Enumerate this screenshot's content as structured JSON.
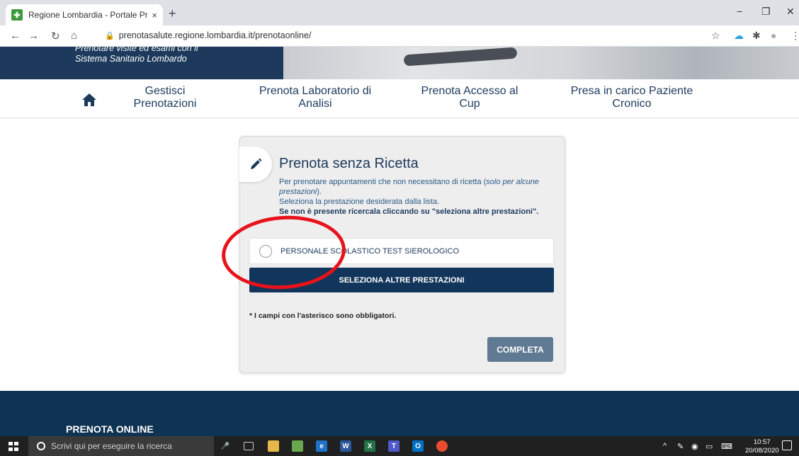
{
  "browser": {
    "tab_title": "Regione Lombardia - Portale Pre",
    "tab_close": "×",
    "new_tab": "+",
    "url": "prenotasalute.regione.lombardia.it/prenotaonline/",
    "window_minimize": "−",
    "window_restore": "❐",
    "window_close": "✕"
  },
  "banner": {
    "line1": "Prenotare visite ed esami con il",
    "line2": "Sistema Sanitario Lombardo"
  },
  "nav": {
    "items": [
      {
        "line1": "Gestisci",
        "line2": "Prenotazioni"
      },
      {
        "line1": "Prenota Laboratorio di",
        "line2": "Analisi"
      },
      {
        "line1": "Prenota Accesso al",
        "line2": "Cup"
      },
      {
        "line1": "Presa in carico Paziente",
        "line2": "Cronico"
      }
    ]
  },
  "card": {
    "title": "Prenota senza Ricetta",
    "desc_part1": "Per prenotare appuntamenti che non necessitano di ricetta (",
    "desc_italic": "solo per alcune prestazioni",
    "desc_part2": ").",
    "desc_line2": "Seleziona la prestazione desiderata dalla lista.",
    "desc_line3": "Se non è presente ricercala cliccando su \"seleziona altre prestazioni\".",
    "option_label": "PERSONALE SCOLASTICO TEST SIEROLOGICO",
    "altre_button": "SELEZIONA ALTRE PRESTAZIONI",
    "required_note": "* I campi con l'asterisco sono obbligatori.",
    "completa_button": "COMPLETA"
  },
  "footer": {
    "title": "PRENOTA ONLINE"
  },
  "taskbar": {
    "search_placeholder": "Scrivi qui per eseguire la ricerca",
    "time": "10:57",
    "date": "20/08/2020"
  },
  "colors": {
    "primary": "#12355b",
    "highlight": "#e8121a",
    "completa": "#5f7a92"
  }
}
